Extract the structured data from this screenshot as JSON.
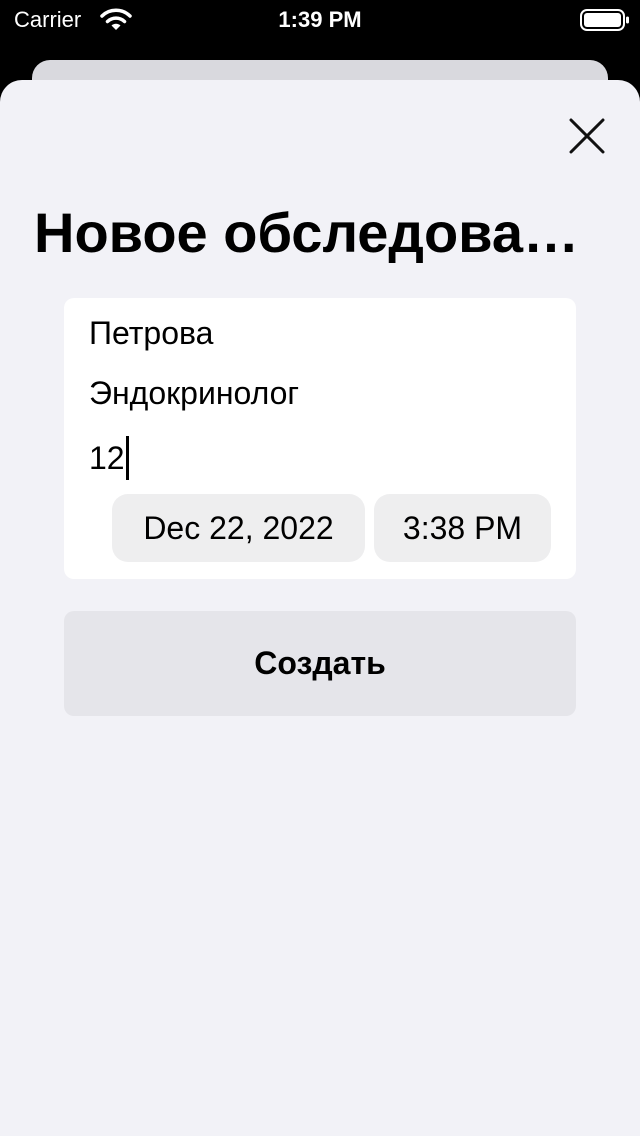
{
  "status_bar": {
    "carrier": "Carrier",
    "time": "1:39 PM",
    "wifi_icon": "wifi-icon",
    "battery_icon": "battery-full-icon"
  },
  "sheet": {
    "close_icon": "close-icon",
    "title": "Новое обследова…"
  },
  "form": {
    "fields": [
      {
        "value": "Петрова"
      },
      {
        "value": "Эндокринолог"
      },
      {
        "value": "12"
      }
    ],
    "date": "Dec 22, 2022",
    "time": "3:38 PM"
  },
  "actions": {
    "create_label": "Создать"
  },
  "colors": {
    "sheet_background": "#f2f2f7",
    "card_background": "#ffffff",
    "pill_background": "#eeeeef",
    "button_background": "#e5e5ea"
  }
}
